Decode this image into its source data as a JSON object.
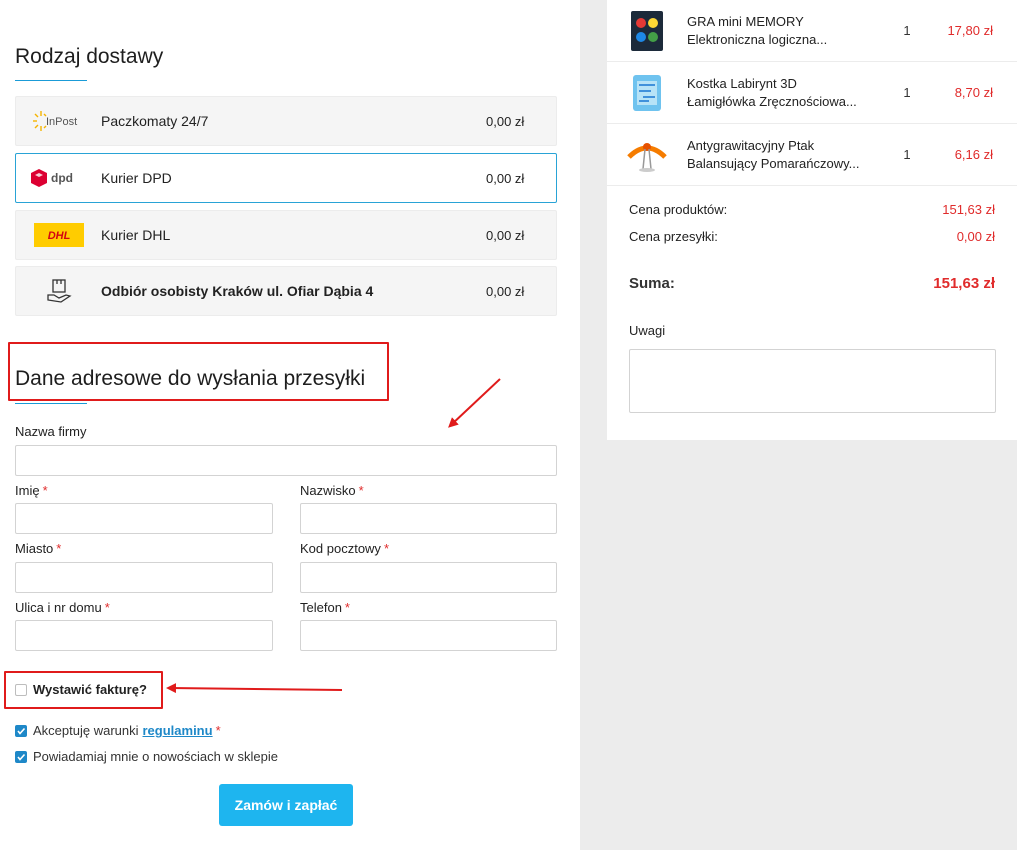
{
  "shipping": {
    "title": "Rodzaj dostawy",
    "options": [
      {
        "logo": "InPost",
        "name": "Paczkomaty 24/7",
        "price": "0,00 zł",
        "selected": false
      },
      {
        "logo": "dpd",
        "name": "Kurier DPD",
        "price": "0,00 zł",
        "selected": true
      },
      {
        "logo": "DHL",
        "name": "Kurier DHL",
        "price": "0,00 zł",
        "selected": false
      },
      {
        "logo": "pickup-icon",
        "name": "Odbiór osobisty Kraków ul. Ofiar Dąbia 4",
        "price": "0,00 zł",
        "selected": false
      }
    ]
  },
  "address": {
    "title": "Dane adresowe do wysłania przesyłki",
    "company_label": "Nazwa firmy",
    "first_name_label": "Imię",
    "last_name_label": "Nazwisko",
    "city_label": "Miasto",
    "postal_label": "Kod pocztowy",
    "street_label": "Ulica i nr domu",
    "phone_label": "Telefon",
    "required_mark": "*"
  },
  "invoice": {
    "label": "Wystawić fakturę?",
    "checked": false
  },
  "terms": {
    "prefix": "Akceptuję warunki",
    "link": "regulaminu",
    "required_mark": "*",
    "checked": true
  },
  "newsletter": {
    "label": "Powiadamiaj mnie o nowościach w sklepie",
    "checked": true
  },
  "submit_label": "Zamów i zapłać",
  "cart": {
    "items": [
      {
        "line1": "GRA mini MEMORY",
        "line2": "Elektroniczna logiczna...",
        "qty": "1",
        "price": "17,80 zł"
      },
      {
        "line1": "Kostka Labirynt 3D",
        "line2": "Łamigłówka Zręcznościowa...",
        "qty": "1",
        "price": "8,70 zł"
      },
      {
        "line1": "Antygrawitacyjny Ptak",
        "line2": "Balansujący Pomarańczowy...",
        "qty": "1",
        "price": "6,16 zł"
      }
    ],
    "products_label": "Cena produktów:",
    "products_value": "151,63 zł",
    "shipping_label": "Cena przesyłki:",
    "shipping_value": "0,00 zł",
    "total_label": "Suma:",
    "total_value": "151,63 zł",
    "notes_label": "Uwagi"
  },
  "colors": {
    "accent": "#1eb5ef",
    "price": "#e02b2b",
    "annotation": "#e01b1b"
  }
}
